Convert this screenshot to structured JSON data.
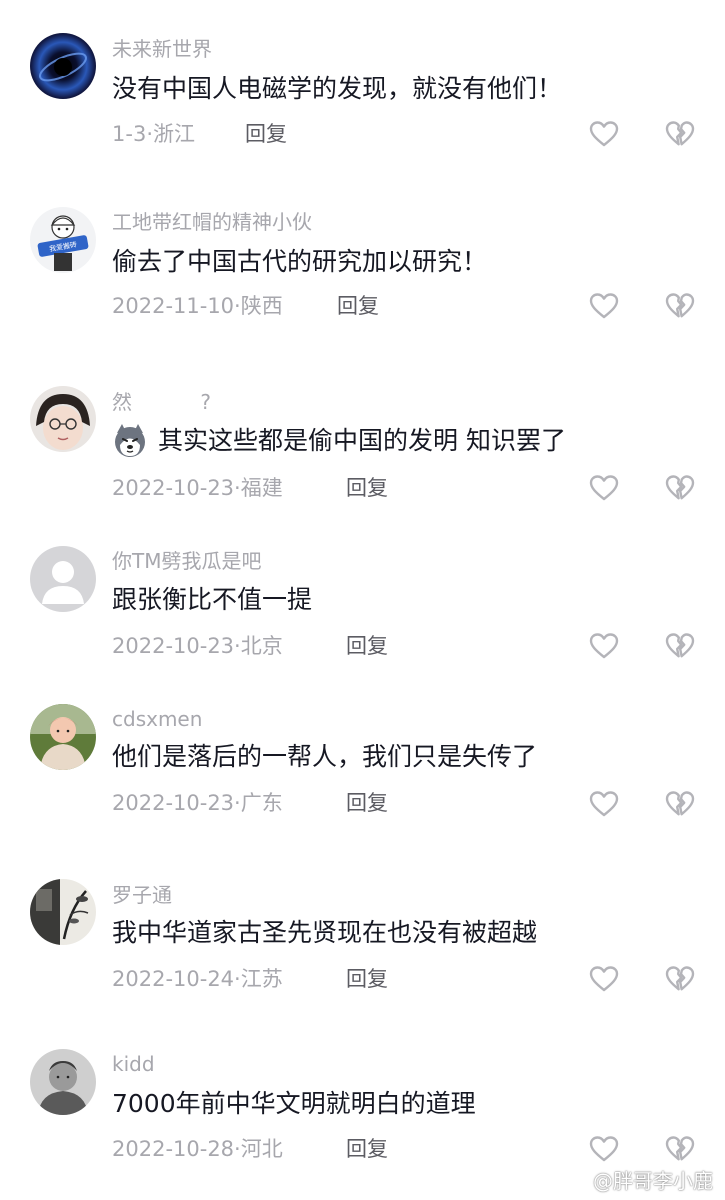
{
  "comments": [
    {
      "username": "未来新世界",
      "text": "没有中国人电磁学的发现，就没有他们！",
      "date": "1-3",
      "separator": "·",
      "location": "浙江",
      "reply_label": "回复",
      "avatar": "galaxy-avatar"
    },
    {
      "username": "工地带红帽的精神小伙",
      "text": "偷去了中国古代的研究加以研究！",
      "date": "2022-11-10",
      "separator": "·",
      "location": "陕西",
      "reply_label": "回复",
      "avatar": "worker-avatar"
    },
    {
      "username": "然",
      "username_suffix": "?",
      "text": "其实这些都是偷中国的发明 知识罢了",
      "emoji": "husky-emoji",
      "date": "2022-10-23",
      "separator": "·",
      "location": "福建",
      "reply_label": "回复",
      "avatar": "girl-avatar"
    },
    {
      "username": "你TM劈我瓜是吧",
      "text": "跟张衡比不值一提",
      "date": "2022-10-23",
      "separator": "·",
      "location": "北京",
      "reply_label": "回复",
      "avatar": "default-avatar"
    },
    {
      "username": "cdsxmen",
      "text": "他们是落后的一帮人，我们只是失传了",
      "date": "2022-10-23",
      "separator": "·",
      "location": "广东",
      "reply_label": "回复",
      "avatar": "baby-avatar"
    },
    {
      "username": "罗子通",
      "text": "我中华道家古圣先贤现在也没有被超越",
      "date": "2022-10-24",
      "separator": "·",
      "location": "江苏",
      "reply_label": "回复",
      "avatar": "ink-painting-avatar"
    },
    {
      "username": "kidd",
      "text": "7000年前中华文明就明白的道理",
      "date": "2022-10-28",
      "separator": "·",
      "location": "河北",
      "reply_label": "回复",
      "avatar": "grayscale-man-avatar"
    }
  ],
  "watermark": {
    "text": "@胖哥李小鹿",
    "icon": "weibo-icon"
  },
  "icons": {
    "like": "heart-outline-icon",
    "dislike": "broken-heart-outline-icon"
  },
  "colors": {
    "username": "#a7a7ad",
    "content": "#161823",
    "meta": "#a7a7ad",
    "reply": "#5c5c63",
    "icon_stroke": "#b4b4b9"
  }
}
